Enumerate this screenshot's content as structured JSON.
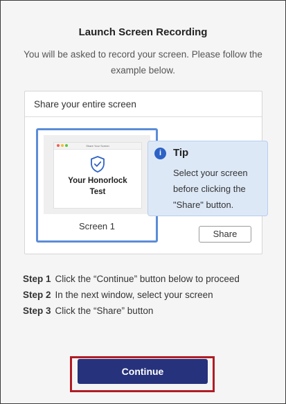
{
  "title": "Launch Screen Recording",
  "subtitle": "You will be asked to record your screen. Please follow the example below.",
  "example": {
    "header": "Share your entire screen",
    "preview": {
      "window_title": "Share Your Screen",
      "line1": "Your Honorlock",
      "line2": "Test"
    },
    "screen_label": "Screen 1",
    "share_label": "Share",
    "selection_color": "#5b8cd8"
  },
  "tip": {
    "icon": "info-icon",
    "title": "Tip",
    "body": "Select your screen before clicking the \"Share\" button."
  },
  "steps": [
    {
      "number": "Step 1",
      "text": "Click the “Continue” button below to proceed"
    },
    {
      "number": "Step 2",
      "text": "In the next window, select your screen"
    },
    {
      "number": "Step 3",
      "text": "Click the “Share” button"
    }
  ],
  "continue_label": "Continue",
  "colors": {
    "primary": "#26327c",
    "highlight_outline": "#b01c25",
    "tip_background": "#dde8f7",
    "info_icon": "#2d62c6"
  }
}
